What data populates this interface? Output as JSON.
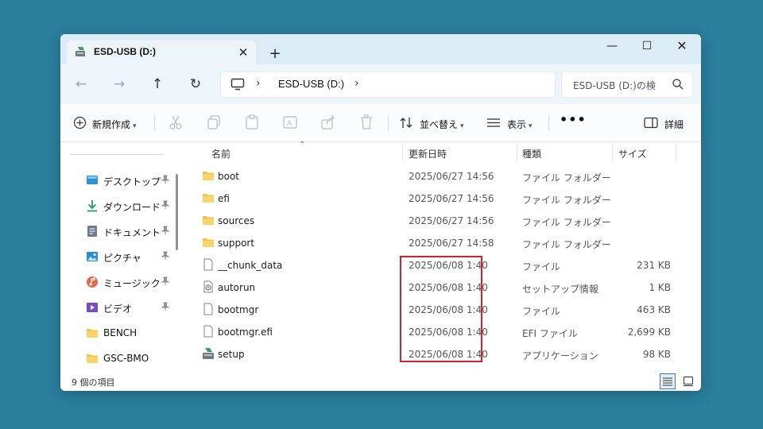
{
  "window": {
    "tab_title": "ESD-USB (D:)",
    "tab_close": "✕",
    "new_tab": "+",
    "minimize": "—",
    "maximize": "☐",
    "close": "✕"
  },
  "nav": {
    "back": "←",
    "forward": "→",
    "up": "↑",
    "refresh": "↻",
    "path_separator": "›",
    "address": "ESD-USB (D:)",
    "search_placeholder": "ESD-USB (D:)の検"
  },
  "toolbar": {
    "new_label": "新規作成",
    "sort_label": "並べ替え",
    "view_label": "表示",
    "more_label": "•••",
    "details_label": "詳細"
  },
  "sidebar": {
    "items": [
      {
        "label": "デスクトップ",
        "icon": "desktop-icon",
        "pinned": true
      },
      {
        "label": "ダウンロード",
        "icon": "download-icon",
        "pinned": true
      },
      {
        "label": "ドキュメント",
        "icon": "documents-icon",
        "pinned": true
      },
      {
        "label": "ピクチャ",
        "icon": "pictures-icon",
        "pinned": true
      },
      {
        "label": "ミュージック",
        "icon": "music-icon",
        "pinned": true
      },
      {
        "label": "ビデオ",
        "icon": "videos-icon",
        "pinned": true
      },
      {
        "label": "BENCH",
        "icon": "folder-icon",
        "pinned": false
      },
      {
        "label": "GSC-BMO",
        "icon": "folder-icon",
        "pinned": false
      }
    ]
  },
  "columns": {
    "name": "名前",
    "modified": "更新日時",
    "type": "種類",
    "size": "サイズ"
  },
  "files": [
    {
      "name": "boot",
      "modified": "2025/06/27 14:56",
      "type": "ファイル フォルダー",
      "size": "",
      "icon": "folder-icon"
    },
    {
      "name": "efi",
      "modified": "2025/06/27 14:56",
      "type": "ファイル フォルダー",
      "size": "",
      "icon": "folder-icon"
    },
    {
      "name": "sources",
      "modified": "2025/06/27 14:56",
      "type": "ファイル フォルダー",
      "size": "",
      "icon": "folder-icon"
    },
    {
      "name": "support",
      "modified": "2025/06/27 14:58",
      "type": "ファイル フォルダー",
      "size": "",
      "icon": "folder-icon"
    },
    {
      "name": "__chunk_data",
      "modified": "2025/06/08 1:40",
      "type": "ファイル",
      "size": "231 KB",
      "icon": "file-icon"
    },
    {
      "name": "autorun",
      "modified": "2025/06/08 1:40",
      "type": "セットアップ情報",
      "size": "1 KB",
      "icon": "setup-info-icon"
    },
    {
      "name": "bootmgr",
      "modified": "2025/06/08 1:40",
      "type": "ファイル",
      "size": "463 KB",
      "icon": "file-icon"
    },
    {
      "name": "bootmgr.efi",
      "modified": "2025/06/08 1:40",
      "type": "EFI ファイル",
      "size": "2,699 KB",
      "icon": "file-icon"
    },
    {
      "name": "setup",
      "modified": "2025/06/08 1:40",
      "type": "アプリケーション",
      "size": "98 KB",
      "icon": "setup-app-icon"
    }
  ],
  "status": {
    "item_count": "9 個の項目"
  },
  "colors": {
    "background": "#2a7f9d",
    "highlight_border": "#d3222a",
    "folder": "#f3c44a",
    "accent": "#3b78c4"
  }
}
